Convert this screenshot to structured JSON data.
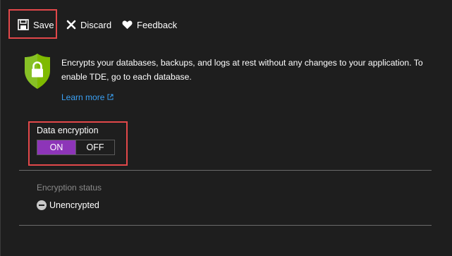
{
  "toolbar": {
    "save_label": "Save",
    "discard_label": "Discard",
    "feedback_label": "Feedback"
  },
  "info": {
    "description": "Encrypts your databases, backups, and logs at rest without any changes to your application. To enable TDE, go to each database.",
    "learn_more": "Learn more"
  },
  "encryption": {
    "label": "Data encryption",
    "on_label": "ON",
    "off_label": "OFF",
    "selected": "ON"
  },
  "status": {
    "label": "Encryption status",
    "value": "Unencrypted"
  },
  "colors": {
    "background": "#1e1e1e",
    "accent_toggle": "#8d35b8",
    "highlight": "#e2484a",
    "shield": "#7fba00",
    "link": "#3aa0f3"
  },
  "icons": {
    "save": "save-icon",
    "discard": "close-icon",
    "feedback": "heart-icon",
    "shield": "shield-lock-icon",
    "external": "external-link-icon",
    "status": "minus-circle-icon"
  }
}
